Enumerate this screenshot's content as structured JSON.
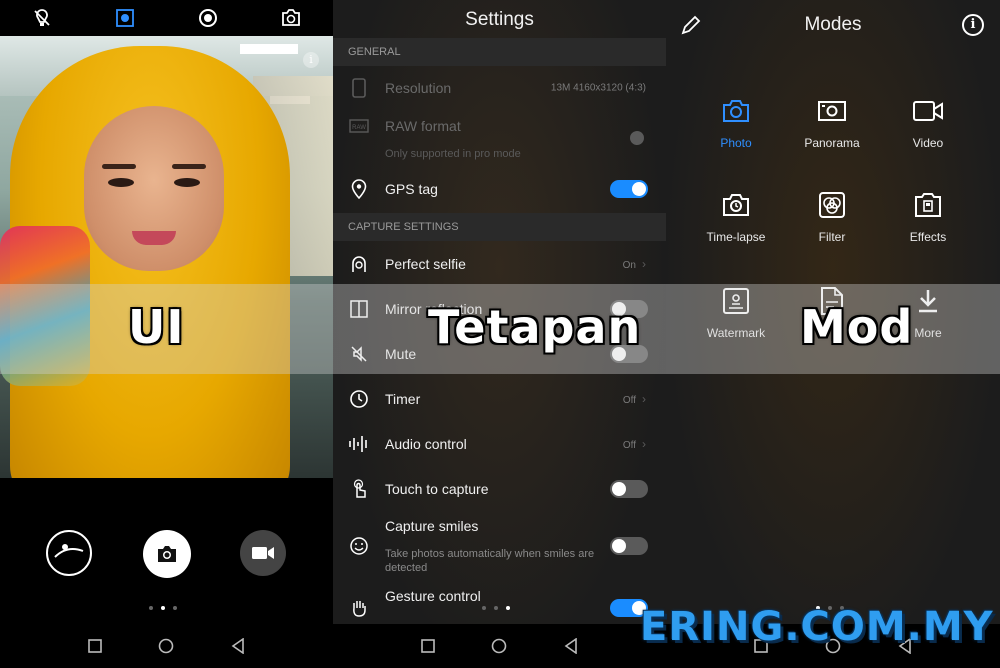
{
  "overlay": {
    "caption_left": "UI",
    "caption_middle": "Tetapan",
    "caption_right": "Mod",
    "watermark": "ERING.COM.MY"
  },
  "camera": {
    "top_icons": [
      "flash-off-icon",
      "aperture-mode-icon",
      "portrait-mode-icon",
      "switch-camera-icon"
    ],
    "beauty_level": "1",
    "page_dots_active": 1
  },
  "settings": {
    "title": "Settings",
    "sections": {
      "general": "GENERAL",
      "capture": "CAPTURE SETTINGS"
    },
    "resolution": {
      "label": "Resolution",
      "value": "13M 4160x3120 (4:3)"
    },
    "raw_format": {
      "label": "RAW format",
      "sub": "Only supported in pro mode"
    },
    "gps_tag": {
      "label": "GPS tag",
      "on": true
    },
    "perfect_selfie": {
      "label": "Perfect selfie",
      "value": "On"
    },
    "mirror_reflection": {
      "label": "Mirror reflection",
      "on": false
    },
    "mute": {
      "label": "Mute",
      "on": false
    },
    "timer": {
      "label": "Timer",
      "value": "Off"
    },
    "audio_control": {
      "label": "Audio control",
      "value": "Off"
    },
    "touch_to_capture": {
      "label": "Touch to capture",
      "on": false
    },
    "capture_smiles": {
      "label": "Capture smiles",
      "sub": "Take photos automatically when smiles are detected",
      "on": false
    },
    "gesture_control": {
      "label": "Gesture control",
      "on": true
    }
  },
  "modes": {
    "title": "Modes",
    "items": [
      {
        "label": "Photo",
        "icon": "camera-icon",
        "active": true
      },
      {
        "label": "Panorama",
        "icon": "panorama-icon",
        "active": false
      },
      {
        "label": "Video",
        "icon": "video-camera-icon",
        "active": false
      },
      {
        "label": "Time-lapse",
        "icon": "time-lapse-icon",
        "active": false
      },
      {
        "label": "Filter",
        "icon": "filter-icon",
        "active": false
      },
      {
        "label": "Effects",
        "icon": "effects-icon",
        "active": false
      },
      {
        "label": "Watermark",
        "icon": "watermark-icon",
        "active": false
      },
      {
        "label": "Document scan",
        "icon": "document-scan-icon",
        "active": false
      },
      {
        "label": "More",
        "icon": "download-icon",
        "active": false
      }
    ]
  },
  "colors": {
    "accent": "#1a8cff",
    "highlight_yellow": "#e4d400",
    "watermark": "#2f9df0"
  }
}
